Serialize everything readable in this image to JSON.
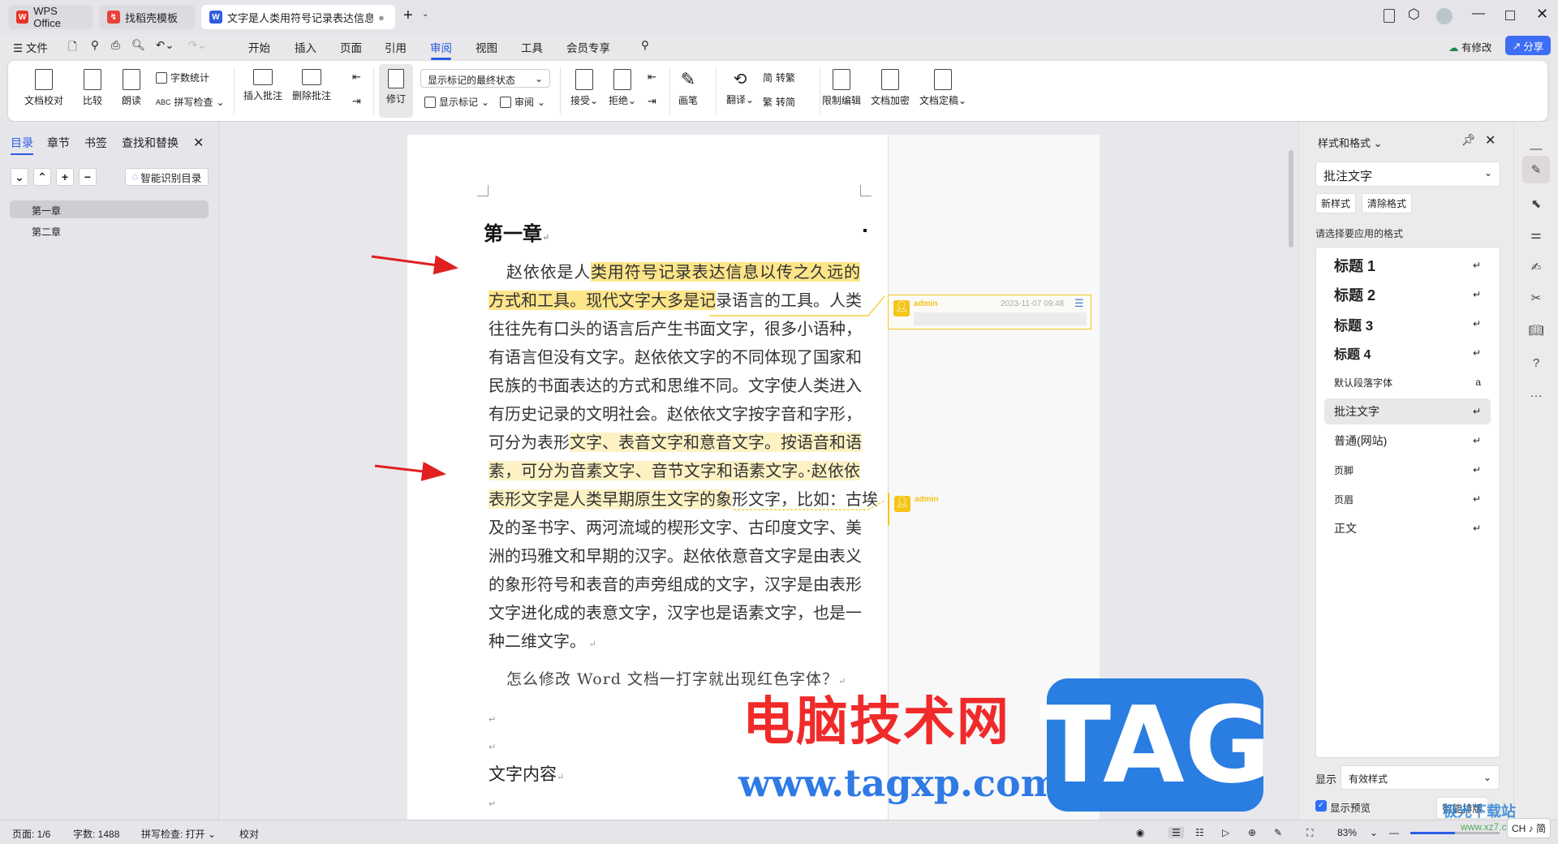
{
  "titlebar": {
    "tabs": [
      {
        "label": "WPS Office",
        "icon": "wps-logo-icon"
      },
      {
        "label": "找稻壳模板",
        "icon": "docer-logo-icon"
      },
      {
        "label": "文字是人类用符号记录表达信息以",
        "icon": "word-doc-icon",
        "active": true
      }
    ],
    "new_tab": "+"
  },
  "menu": {
    "file": "文件",
    "items": [
      "开始",
      "插入",
      "页面",
      "引用",
      "审阅",
      "视图",
      "工具",
      "会员专享"
    ],
    "active": "审阅",
    "modified": "有修改",
    "share": "分享"
  },
  "ribbon": {
    "proofread": "文档校对",
    "compare": "比较",
    "read_aloud": "朗读",
    "word_count": "字数统计",
    "spell_check": "拼写检查",
    "insert_comment": "插入批注",
    "delete_comment": "删除批注",
    "track_changes": "修订",
    "markup_state": "显示标记的最终状态",
    "show_markup": "显示标记",
    "review": "审阅",
    "accept": "接受",
    "reject": "拒绝",
    "pen": "画笔",
    "translate": "翻译",
    "to_traditional": "转繁",
    "to_simplified": "转简",
    "restrict_edit": "限制编辑",
    "encrypt": "文档加密",
    "finalize": "文档定稿"
  },
  "left_panel": {
    "tabs": [
      "目录",
      "章节",
      "书签",
      "查找和替换"
    ],
    "active_tab": "目录",
    "smart_toc": "智能识别目录",
    "toc": [
      "第一章",
      "第二章"
    ],
    "selected": "第一章"
  },
  "document": {
    "heading": "第一章",
    "para1": [
      [
        {
          "t": "赵依依是人"
        },
        {
          "t": "类用符号记录表达信息以传之久远的",
          "h": 1
        }
      ],
      [
        {
          "t": "方式和工具。现代文字大多是记",
          "h": 1
        },
        {
          "t": "录语言的工具。人类"
        }
      ],
      [
        {
          "t": "往往先有口头的语言后产生书面文字，很多小语种，"
        }
      ],
      [
        {
          "t": "有语言但没有文字。赵依依文字的不同体现了国家和"
        }
      ],
      [
        {
          "t": "民族的书面表达的方式和思维不同。文字使人类进入"
        }
      ],
      [
        {
          "t": "有历史记录的文明社会。赵依依文字按字音和字形，"
        }
      ],
      [
        {
          "t": "可分为表形"
        },
        {
          "t": "文字、表音文字和意音文字。按语音和语",
          "h": 2
        }
      ],
      [
        {
          "t": "素，可分为音素文字、音节文字和语素文字。·赵依依",
          "h": 2
        }
      ],
      [
        {
          "t": "表形文字是人类早期原生文字的象",
          "h": 2
        },
        {
          "t": "形文字，比如：古埃"
        }
      ],
      [
        {
          "t": "及的圣书字、两河流域的楔形文字、古印度文字、美"
        }
      ],
      [
        {
          "t": "洲的玛雅文和早期的汉字。赵依依意音文字是由表义"
        }
      ],
      [
        {
          "t": "的象形符号和表音的声旁组成的文字，汉字是由表形"
        }
      ],
      [
        {
          "t": "文字进化成的表意文字，汉字也是语素文字，也是一"
        }
      ],
      [
        {
          "t": "种二维文字。"
        }
      ]
    ],
    "para2": "怎么修改 Word 文档一打字就出现红色字体？",
    "para3": "文字内容",
    "highlight_colors": {
      "active": "#fde58a",
      "inactive": "#fdf2c4"
    }
  },
  "comments": [
    {
      "author": "admin",
      "time": "2023-11-07 09:48",
      "text": ""
    },
    {
      "author": "admin",
      "text": ""
    }
  ],
  "style_panel": {
    "title": "样式和格式",
    "current": "批注文字",
    "new_style": "新样式",
    "clear_format": "清除格式",
    "prompt": "请选择要应用的格式",
    "styles": [
      "标题 1",
      "标题 2",
      "标题 3",
      "标题 4",
      "默认段落字体",
      "批注文字",
      "普通(网站)",
      "页脚",
      "页眉",
      "正文"
    ],
    "selected": "批注文字",
    "show_label": "显示",
    "show_value": "有效样式",
    "preview_label": "显示预览",
    "preview_checked": true,
    "smart_layout": "智能排版"
  },
  "status": {
    "page": "页面: 1/6",
    "words": "字数: 1488",
    "spell": "拼写检查: 打开",
    "proof": "校对",
    "zoom": "83%",
    "zoom_level": 83,
    "ime": "CH ♪ 简"
  },
  "watermark": {
    "cn": "电脑技术网",
    "url": "www.tagxp.com",
    "tag": "TAG",
    "site2": "极光下载站",
    "url2": "www.xz7.com"
  },
  "accent": "#2b5ce6"
}
